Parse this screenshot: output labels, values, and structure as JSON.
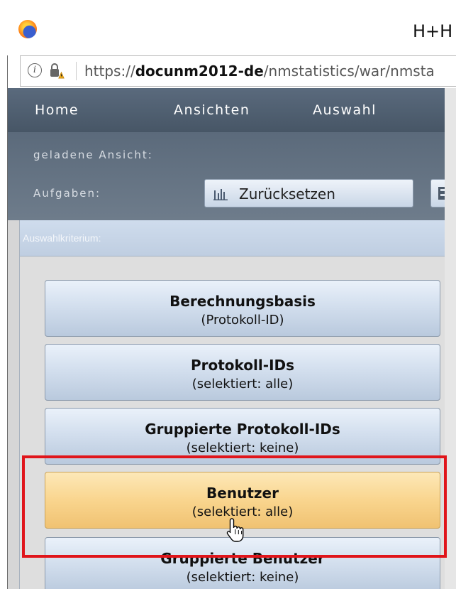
{
  "window": {
    "title": "H+H N"
  },
  "address_bar": {
    "url_prefix": "https://",
    "url_domain": "docunm2012-de",
    "url_path": "/nmstatistics/war/nmsta"
  },
  "nav": {
    "items": [
      {
        "label": "Home"
      },
      {
        "label": "Ansichten"
      },
      {
        "label": "Auswahl"
      }
    ]
  },
  "toolbar": {
    "loaded_view_label": "geladene Ansicht:",
    "tasks_label": "Aufgaben:",
    "reset_button": "Zurücksetzen"
  },
  "panel": {
    "header": "Auswahlkriterium:",
    "criteria": [
      {
        "title": "Berechnungsbasis",
        "subtitle": "(Protokoll-ID)",
        "selected": false
      },
      {
        "title": "Protokoll-IDs",
        "subtitle": "(selektiert: alle)",
        "selected": false
      },
      {
        "title": "Gruppierte Protokoll-IDs",
        "subtitle": "(selektiert: keine)",
        "selected": false
      },
      {
        "title": "Benutzer",
        "subtitle": "(selektiert: alle)",
        "selected": true
      },
      {
        "title": "Gruppierte Benutzer",
        "subtitle": "(selektiert: keine)",
        "selected": false
      }
    ]
  },
  "colors": {
    "nav_bg": "#4f5e70",
    "selected_button": "#f9d58e",
    "highlight_frame": "#e0151b"
  }
}
